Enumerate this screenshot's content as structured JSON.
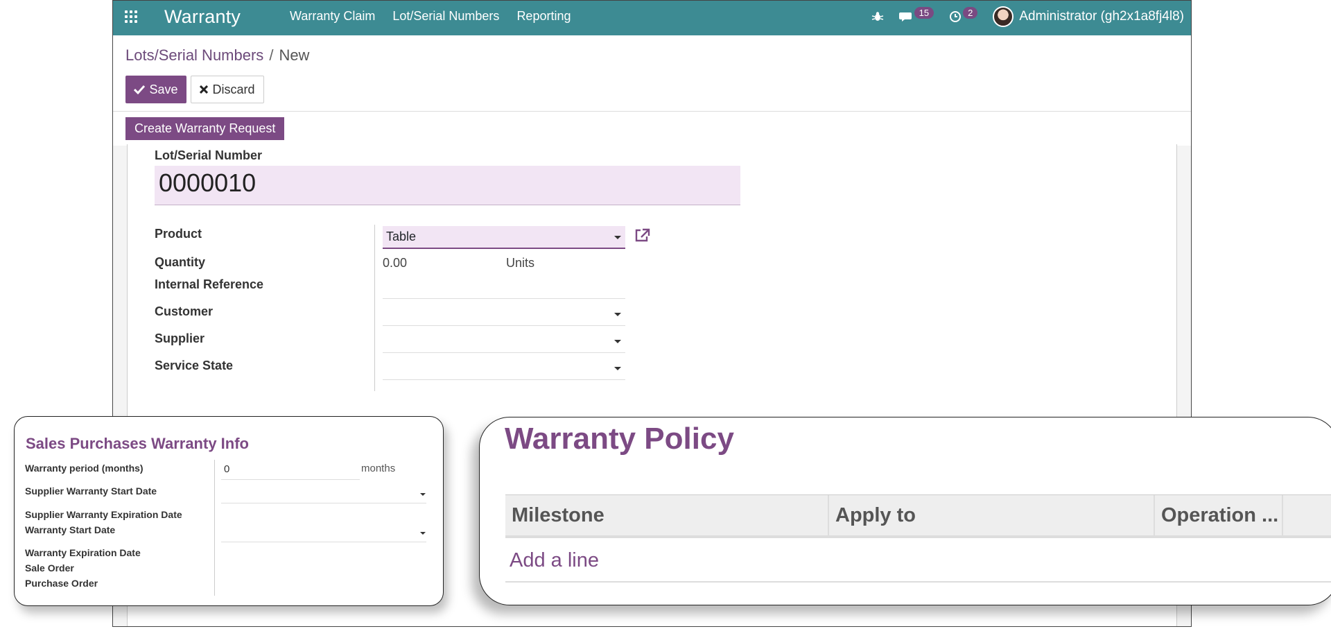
{
  "navbar": {
    "brand": "Warranty",
    "menu": [
      "Warranty Claim",
      "Lot/Serial Numbers",
      "Reporting"
    ],
    "messages_count": "15",
    "activities_count": "2",
    "user": "Administrator (gh2x1a8fj4l8)"
  },
  "breadcrumb": {
    "parent": "Lots/Serial Numbers",
    "separator": "/",
    "current": "New"
  },
  "buttons": {
    "save": "Save",
    "discard": "Discard",
    "create_warranty_request": "Create Warranty Request"
  },
  "form": {
    "lot_label": "Lot/Serial Number",
    "lot_value": "0000010",
    "fields": {
      "product_label": "Product",
      "product_value": "Table",
      "quantity_label": "Quantity",
      "quantity_value": "0.00",
      "quantity_unit": "Units",
      "internal_ref_label": "Internal Reference",
      "customer_label": "Customer",
      "supplier_label": "Supplier",
      "service_state_label": "Service State"
    }
  },
  "sales_panel": {
    "title": "Sales Purchases Warranty Info",
    "warranty_period_label": "Warranty period (months)",
    "warranty_period_value": "0",
    "warranty_period_unit": "months",
    "supplier_start_label": "Supplier Warranty Start Date",
    "supplier_exp_label": "Supplier Warranty Expiration Date",
    "warranty_start_label": "Warranty Start Date",
    "warranty_exp_label": "Warranty Expiration Date",
    "sale_order_label": "Sale Order",
    "purchase_order_label": "Purchase Order"
  },
  "policy_panel": {
    "title": "Warranty Policy",
    "columns": [
      "Milestone",
      "Apply to",
      "Operation ..."
    ],
    "add_line": "Add a line"
  },
  "colors": {
    "navbar": "#3d8b93",
    "primary": "#7c4a84",
    "input_bg": "#f2e5f4"
  }
}
